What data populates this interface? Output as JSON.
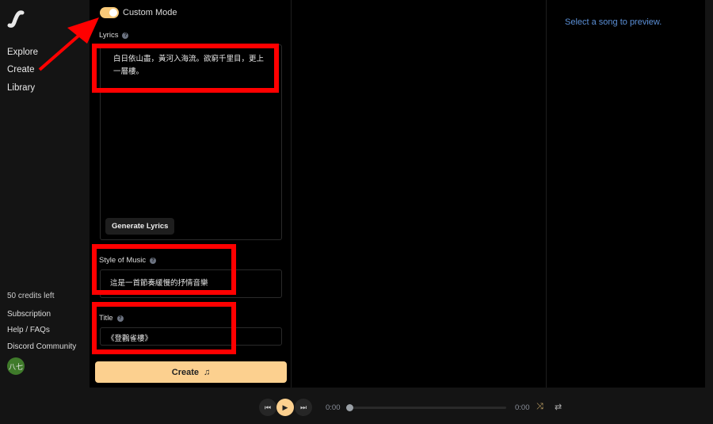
{
  "sidebar": {
    "nav": [
      {
        "label": "Explore"
      },
      {
        "label": "Create"
      },
      {
        "label": "Library"
      }
    ],
    "credits": "50 credits left",
    "links": [
      {
        "label": "Subscription"
      },
      {
        "label": "Help / FAQs"
      },
      {
        "label": "Discord Community"
      }
    ],
    "avatar": "八七"
  },
  "form": {
    "custom_mode": "Custom Mode",
    "custom_mode_on": true,
    "lyrics_label": "Lyrics",
    "lyrics_value": "白日依山盡，黃河入海流。欲窮千里目，更上一層樓。",
    "generate_lyrics": "Generate Lyrics",
    "style_label": "Style of Music",
    "style_value": "這是一首節奏緩慢的抒情音樂",
    "title_label": "Title",
    "title_value": "《登鸛雀樓》",
    "create_label": "Create"
  },
  "preview": {
    "text": "Select a song to preview."
  },
  "player": {
    "current_time": "0:00",
    "duration": "0:00",
    "progress": 0
  },
  "colors": {
    "accent": "#fcd08f",
    "annotation": "#ff0000",
    "preview_text": "#5b8fd6"
  }
}
